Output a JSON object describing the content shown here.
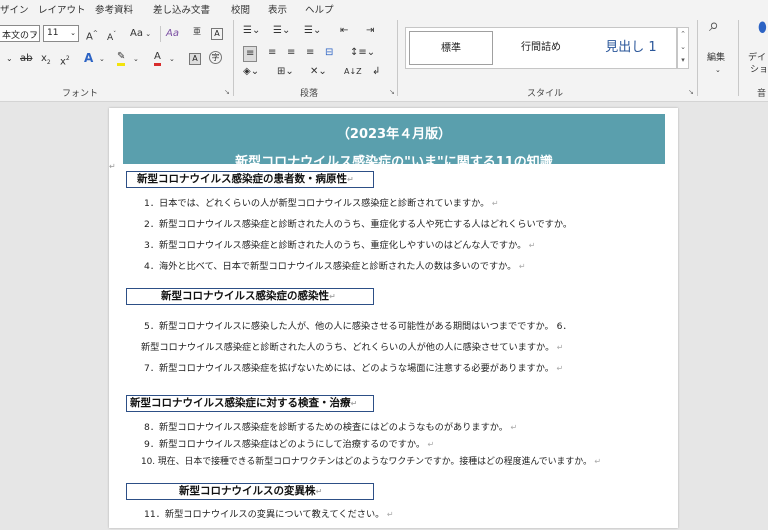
{
  "menu": {
    "tabs": [
      "ザイン",
      "レイアウト",
      "参考資料",
      "差し込み文書",
      "校閲",
      "表示",
      "ヘルプ"
    ]
  },
  "ribbon": {
    "font": {
      "font_name": "本文のフ",
      "font_size": "11",
      "grow_label": "A",
      "shrink_label": "A",
      "case_label": "Aa",
      "clear_format_label": "Aa",
      "strike_label": "ab",
      "subscript_label": "x",
      "superscript_label": "x",
      "effects_label": "A",
      "font_color_label": "A",
      "group_label": "フォント"
    },
    "paragraph": {
      "group_label": "段落",
      "sort_label": "A↓Z"
    },
    "styles": {
      "items": [
        "標準",
        "行間詰め",
        "見出し 1"
      ],
      "group_label": "スタイル"
    },
    "editing": {
      "label": "編集"
    },
    "design": {
      "label_1": "デイ",
      "label_2": "ショ"
    },
    "audio_label": "音"
  },
  "document": {
    "banner_title": "（2023年４月版）",
    "banner_subtitle": "新型コロナウイルス感染症の\"いま\"に関する11の知識",
    "sections": [
      {
        "heading": "新型コロナウイルス感染症の患者数・病原性",
        "lines": [
          "1．日本では、どれくらいの人が新型コロナウイルス感染症と診断されていますか。",
          "2．新型コロナウイルス感染症と診断された人のうち、重症化する人や死亡する人はどれくらいですか。",
          "3．新型コロナウイルス感染症と診断された人のうち、重症化しやすいのはどんな人ですか。",
          "4．海外と比べて、日本で新型コロナウイルス感染症と診断された人の数は多いのですか。"
        ]
      },
      {
        "heading": "新型コロナウイルス感染症の感染性",
        "lines": [
          "5．新型コロナウイルスに感染した人が、他の人に感染させる可能性がある期間はいつまでですか。 6．",
          "新型コロナウイルス感染症と診断された人のうち、どれくらいの人が他の人に感染させていますか。",
          "7．新型コロナウイルス感染症を拡げないためには、どのような場面に注意する必要がありますか。"
        ]
      },
      {
        "heading": "新型コロナウイルス感染症に対する検査・治療",
        "lines": [
          "8．新型コロナウイルス感染症を診断するための検査にはどのようなものがありますか。",
          "9．新型コロナウイルス感染症はどのようにして治療するのですか。",
          "10. 現在、日本で接種できる新型コロナワクチンはどのようなワクチンですか。接種はどの程度進んでいますか。"
        ]
      },
      {
        "heading": "新型コロナウイルスの変異株",
        "lines": [
          "11．新型コロナウイルスの変異について教えてください。"
        ]
      }
    ],
    "paragraph_mark": "↵",
    "colors": {
      "banner": "#5a9fad",
      "heading_border": "#2d4f86"
    }
  }
}
